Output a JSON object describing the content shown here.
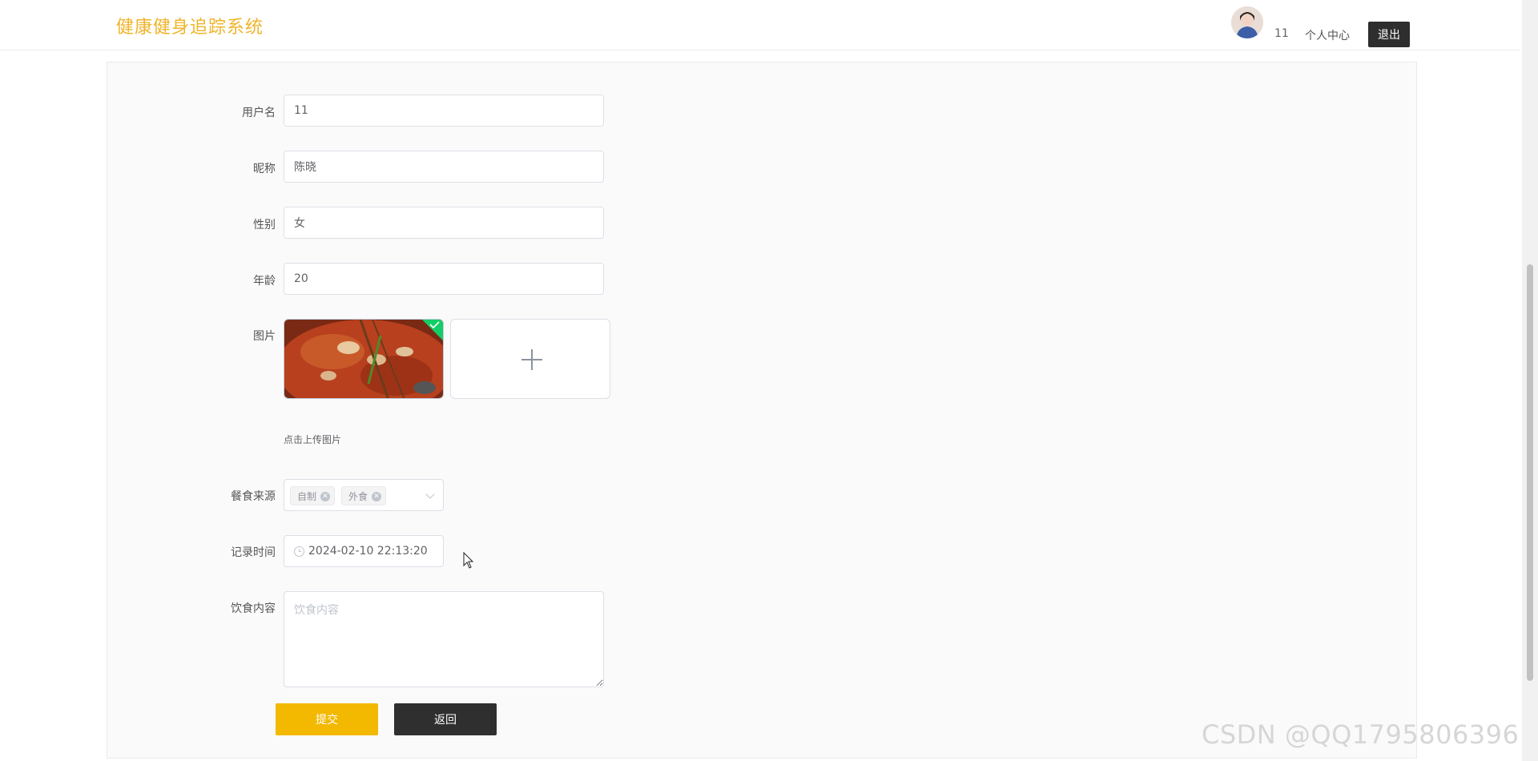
{
  "header": {
    "logo": "健康健身追踪系统",
    "username": "11",
    "center_link": "个人中心",
    "logout": "退出"
  },
  "form": {
    "username": {
      "label": "用户名",
      "value": "11"
    },
    "nickname": {
      "label": "昵称",
      "value": "陈晓"
    },
    "gender": {
      "label": "性别",
      "value": "女"
    },
    "age": {
      "label": "年龄",
      "value": "20"
    },
    "picture": {
      "label": "图片",
      "tip": "点击上传图片"
    },
    "meal_source": {
      "label": "餐食来源",
      "tags": [
        "自制",
        "外食"
      ]
    },
    "record_time": {
      "label": "记录时间",
      "value": "2024-02-10 22:13:20"
    },
    "diet_content": {
      "label": "饮食内容",
      "placeholder": "饮食内容"
    }
  },
  "buttons": {
    "submit": "提交",
    "back": "返回"
  },
  "watermark": "CSDN @QQ1795806396",
  "colors": {
    "brand": "#f0b429",
    "submit": "#f3b800",
    "dark": "#2f2f2f"
  }
}
